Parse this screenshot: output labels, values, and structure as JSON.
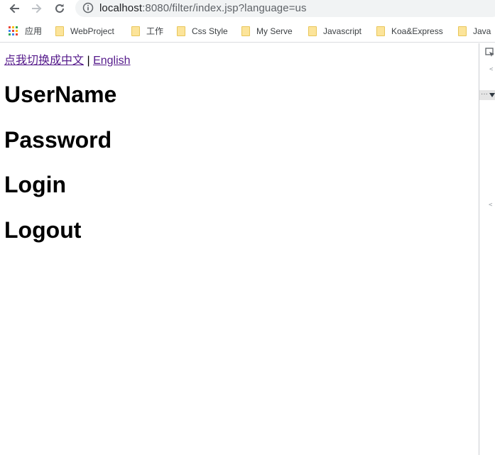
{
  "browser": {
    "url_host": "localhost",
    "url_path": ":8080/filter/index.jsp?language=us"
  },
  "bookmarks": [
    {
      "label": "应用",
      "icon": "apps-icon"
    },
    {
      "label": "WebProject",
      "icon": "folder-icon"
    },
    {
      "label": "工作",
      "icon": "folder-icon"
    },
    {
      "label": "Css Style",
      "icon": "folder-icon"
    },
    {
      "label": "My Serve",
      "icon": "folder-icon"
    },
    {
      "label": "Javascript",
      "icon": "folder-icon"
    },
    {
      "label": "Koa&Express",
      "icon": "folder-icon"
    },
    {
      "label": "Java",
      "icon": "folder-icon"
    }
  ],
  "page": {
    "link_chinese": "点我切换成中文",
    "separator": "|",
    "link_english": "English",
    "headings": {
      "username": "UserName",
      "password": "Password",
      "login": "Login",
      "logout": "Logout"
    }
  },
  "devtools": {
    "tag_open": "<",
    "dots": "···",
    "tag_close": "<"
  },
  "colors": {
    "visited_link": "#551a8b",
    "omnibox_bg": "#f1f3f4",
    "folder": "#fce49a"
  }
}
